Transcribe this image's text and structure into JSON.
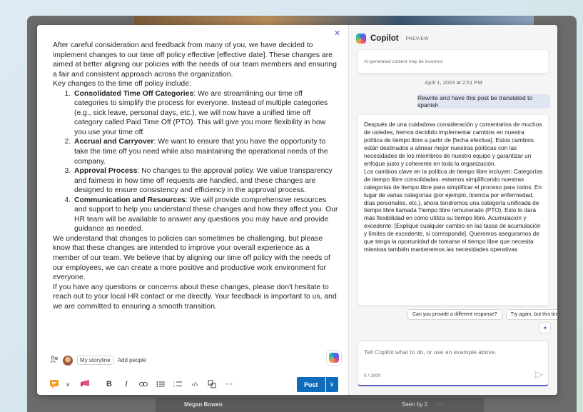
{
  "post": {
    "intro": "After careful consideration and feedback from many of you, we have decided to implement changes to our time off policy effective [effective date]. These changes are aimed at better aligning our policies with the needs of our team members and ensuring a fair and consistent approach across the organization.",
    "key_changes": "Key changes to the time off policy include:",
    "items": [
      {
        "title": "Consolidated Time Off Categories",
        "text": ": We are streamlining our time off categories to simplify the process for everyone. Instead of multiple categories (e.g., sick leave, personal days, etc.), we will now have a unified time off category called Paid Time Off (PTO). This will give you more flexibility in how you use your time off."
      },
      {
        "title": "Accrual and Carryover",
        "text": ":  We want to ensure that you have the opportunity to take the time off you need while also maintaining the operational needs of the company."
      },
      {
        "title": "Approval Process",
        "text": ": No changes to the approval policy.  We value transparency and fairness in how time off requests are handled, and these changes are designed to ensure consistency and efficiency in the approval process."
      },
      {
        "title": "Communication and Resources",
        "text": ": We will provide comprehensive resources and support to help you understand these changes and how they affect you. Our HR team will be available to answer any questions you may have and provide guidance as needed."
      }
    ],
    "para2": "We understand that changes to policies can sometimes be challenging, but please know that these changes are intended to improve your overall experience as a member of our team. We believe that by aligning our time off policy with the needs of our employees, we can create a more positive and productive work environment for everyone.",
    "para3": "If you have any questions or concerns about these changes, please don't hesitate to reach out to your local HR contact or me directly. Your feedback is important to us, and we are committed to ensuring a smooth transition."
  },
  "meta": {
    "storyline_label": "My storyline",
    "add_people_label": "Add people"
  },
  "toolbar": {
    "post_label": "Post",
    "bold": "B",
    "italic": "I",
    "more": "···"
  },
  "copilot": {
    "title": "Copilot",
    "badge": "PREVIEW",
    "disclaimer": "AI-generated content may be incorrect",
    "timestamp": "April 1, 2024 at 2:51 PM",
    "user_message": "Rewrite and have this post be translated to spanish",
    "response": "Después de una cuidadosa consideración y comentarios de muchos de ustedes, hemos decidido implementar cambios en nuestra política de tiempo libre a partir de [fecha efectiva]. Estos cambios están destinados a alinear mejor nuestras políticas con las necesidades de los miembros de nuestro equipo y garantizar un enfoque justo y coherente en toda la organización.\nLos cambios clave en la política de tiempo libre incluyen: Categorías de tiempo libre consolidadas: estamos simplificando nuestras categorías de tiempo libre para simplificar el proceso para todos. En lugar de varias categorías (por ejemplo, licencia por enfermedad, días personales, etc.), ahora tendremos una categoría unificada de tiempo libre llamada Tiempo libre remunerado (PTO). Esto le dará más flexibilidad en cómo utiliza su tiempo libre. Acumulación y excedente: [Explique cualquier cambio en las tasas de acumulación y límites de excedente, si corresponde]. Queremos asegurarnos de que tenga la oportunidad de tomarse el tiempo libre que necesita mientras también mantenemos las necesidades operativas",
    "suggestions": [
      "Can you provide a different response?",
      "Try again, but this time..."
    ],
    "input_placeholder": "Tell Copilot what to do, or use an example above.",
    "counter": "0 / 2000"
  },
  "background": {
    "name": "Megan Bowen",
    "seen": "Seen by 2",
    "more": "···"
  },
  "colors": {
    "accent": "#5b5fc7",
    "post_button": "#0f6cbd",
    "user_bubble": "#e0e5f4"
  }
}
